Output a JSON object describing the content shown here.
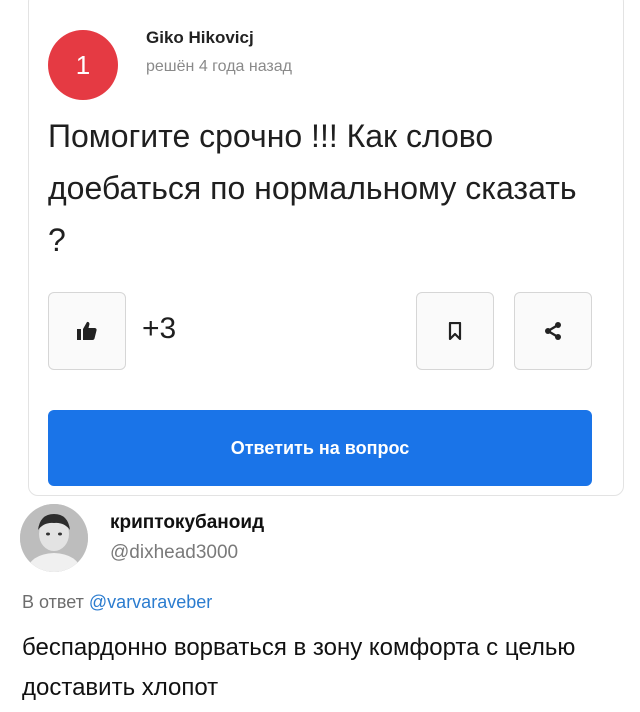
{
  "question": {
    "rank_number": "1",
    "author_name": "Giko Hikovicj",
    "status": "решён 4 года назад",
    "text": "Помогите срочно !!! Как слово доебаться по нормальному сказать ?",
    "like_count": "+3",
    "answer_button_label": "Ответить на вопрос"
  },
  "icons": {
    "like": "thumbs-up-icon",
    "bookmark": "bookmark-icon",
    "share": "share-icon"
  },
  "colors": {
    "badge": "#e53a43",
    "answer_button": "#1a74e8",
    "mention": "#2b7ccf"
  },
  "reply": {
    "display_name": "криптокубаноид",
    "handle": "@dixhead3000",
    "in_reply_to_prefix": "В ответ",
    "in_reply_to_handle": "@varvaraveber",
    "text": "беспардонно ворваться в зону комфорта с целью доставить хлопот"
  }
}
